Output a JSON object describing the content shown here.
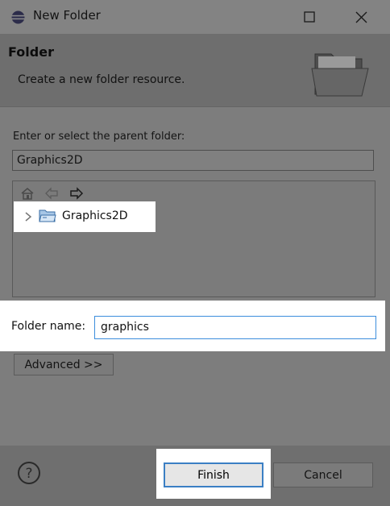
{
  "window": {
    "title": "New Folder"
  },
  "header": {
    "title": "Folder",
    "description": "Create a new folder resource."
  },
  "parent": {
    "label": "Enter or select the parent folder:",
    "value": "Graphics2D"
  },
  "tree": {
    "items": [
      {
        "label": "Graphics2D"
      }
    ]
  },
  "folder_name": {
    "label": "Folder name:",
    "value": "graphics"
  },
  "buttons": {
    "advanced": "Advanced >>",
    "finish": "Finish",
    "cancel": "Cancel"
  },
  "icons": {
    "app": "eclipse-icon",
    "maximize": "maximize-icon",
    "close": "close-icon",
    "banner": "folder-open-icon",
    "home": "home-icon",
    "back": "back-arrow-icon",
    "forward": "forward-arrow-icon",
    "expand": "chevron-right-icon",
    "tree_folder": "project-folder-icon",
    "help": "help-icon"
  },
  "colors": {
    "focus": "#3b7fc4",
    "highlight": "#ffffff",
    "dim_overlay": "#7d7d7d"
  }
}
